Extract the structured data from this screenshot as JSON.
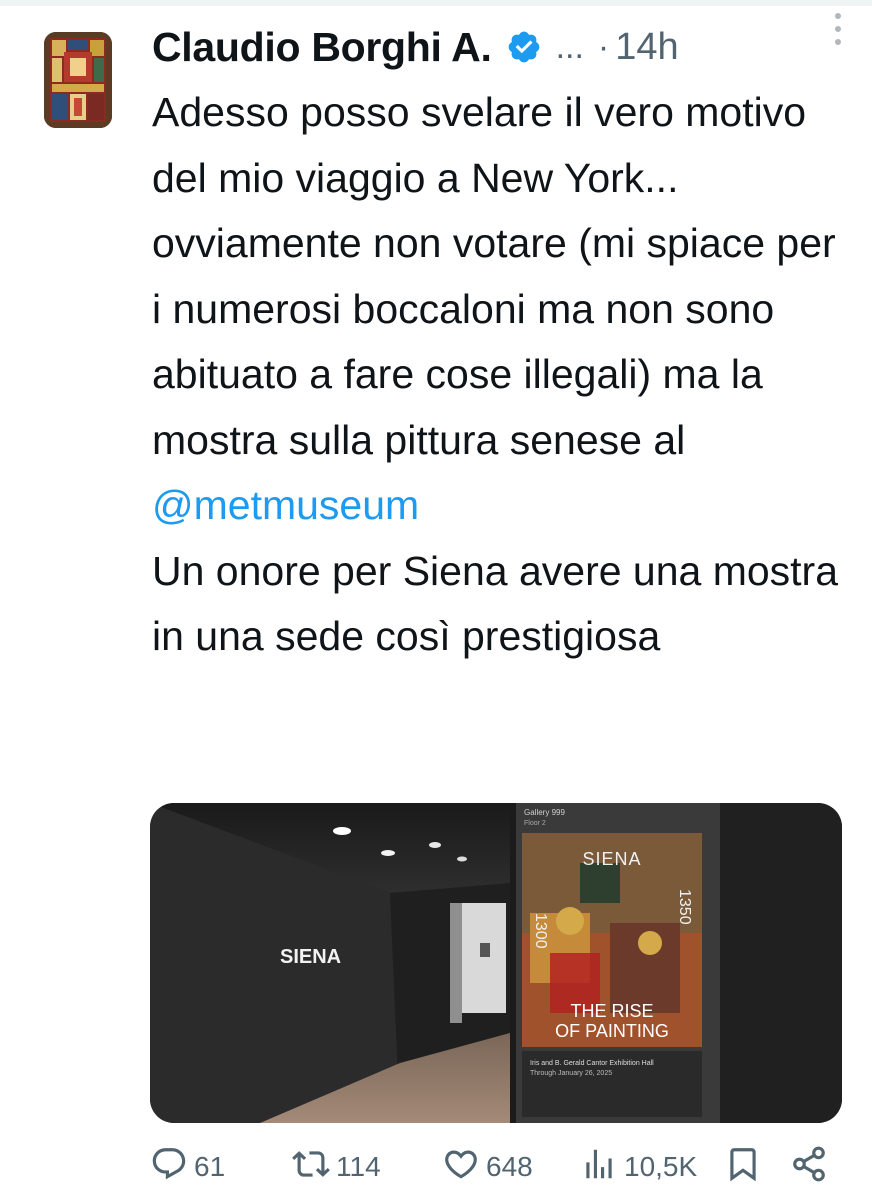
{
  "author": {
    "name": "Claudio Borghi A.",
    "ellipsis": "...",
    "separator": "·",
    "time": "14h"
  },
  "tweet": {
    "text_before_mention": "Adesso posso svelare il vero motivo del mio viaggio a New York... ovviamente non votare (mi spiace per i numerosi boccaloni ma non sono abituato a fare cose illegali) ma la mostra sulla pittura senese al ",
    "mention": "@metmuseum",
    "text_after_mention": "Un onore per Siena avere una mostra in una sede così prestigiosa"
  },
  "media": {
    "wall_text": "SIENA",
    "poster_title": "SIENA",
    "poster_year_start": "1300",
    "poster_year_end": "1350",
    "poster_subtitle_1": "THE RISE",
    "poster_subtitle_2": "OF PAINTING",
    "gallery_label_1": "Gallery 999",
    "gallery_label_2": "Floor 2",
    "hall_text": "Iris and B. Gerald Cantor Exhibition Hall",
    "dates_text": "Through January 26, 2025"
  },
  "actions": {
    "replies": "61",
    "retweets": "114",
    "likes": "648",
    "views": "10,5K"
  },
  "colors": {
    "accent": "#1d9bf0",
    "muted": "#536471"
  }
}
